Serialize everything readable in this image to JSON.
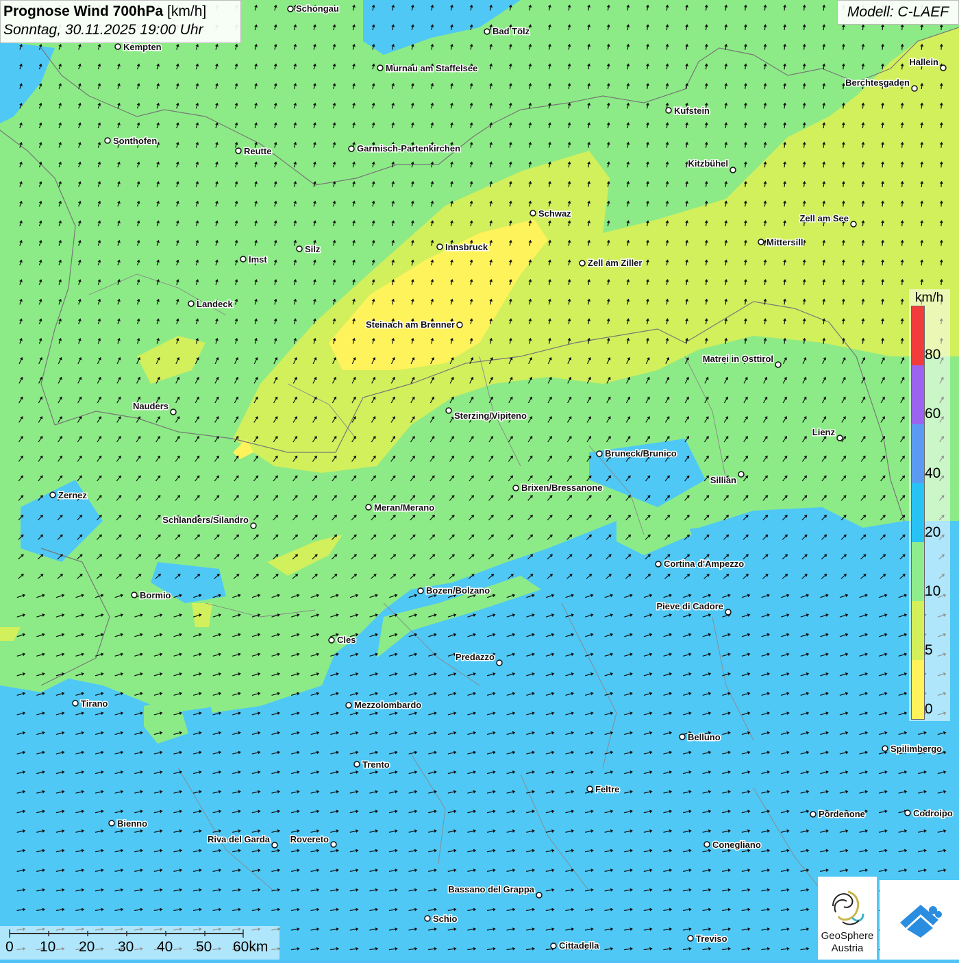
{
  "header": {
    "title_bold": "Prognose Wind 700hPa",
    "title_unit": "[km/h]",
    "datetime": "Sonntag, 30.11.2025 19:00 Uhr",
    "model": "Modell: C-LAEF"
  },
  "legend": {
    "unit": "km/h",
    "labels": [
      "80",
      "60",
      "40",
      "20",
      "10",
      "5",
      "0"
    ],
    "colors": [
      "#f23c3c",
      "#9b63f0",
      "#5b9af2",
      "#28c3f5",
      "#8fec8c",
      "#d3f05a",
      "#fff25a"
    ]
  },
  "scale_bar": {
    "labels": [
      "0",
      "10",
      "20",
      "30",
      "40",
      "50",
      "60km"
    ]
  },
  "logos": {
    "geosphere_line1": "GeoSphere",
    "geosphere_line2": "Austria"
  },
  "cities": [
    {
      "name": "Schongau"
    },
    {
      "name": "Bad Tölz"
    },
    {
      "name": "Kempten"
    },
    {
      "name": "Murnau am Staffelsee"
    },
    {
      "name": "Hallein"
    },
    {
      "name": "Berchtesgaden"
    },
    {
      "name": "Kufstein"
    },
    {
      "name": "Sonthofen"
    },
    {
      "name": "Reutte"
    },
    {
      "name": "Garmisch-Partenkirchen"
    },
    {
      "name": "Kitzbühel"
    },
    {
      "name": "Schwaz"
    },
    {
      "name": "Zell am See"
    },
    {
      "name": "Innsbruck"
    },
    {
      "name": "Mittersill"
    },
    {
      "name": "Silz"
    },
    {
      "name": "Imst"
    },
    {
      "name": "Zell am Ziller"
    },
    {
      "name": "Landeck"
    },
    {
      "name": "Steinach am Brenner"
    },
    {
      "name": "Matrei in Osttirol"
    },
    {
      "name": "Nauders"
    },
    {
      "name": "Sterzing/Vipiteno"
    },
    {
      "name": "Lienz"
    },
    {
      "name": "Bruneck/Brunico"
    },
    {
      "name": "Sillian"
    },
    {
      "name": "Brixen/Bressanone"
    },
    {
      "name": "Zernez"
    },
    {
      "name": "Meran/Merano"
    },
    {
      "name": "Schlanders/Silandro"
    },
    {
      "name": "Cortina d'Ampezzo"
    },
    {
      "name": "Bozen/Bolzano"
    },
    {
      "name": "Bormio"
    },
    {
      "name": "Pieve di Cadore"
    },
    {
      "name": "Cles"
    },
    {
      "name": "Predazzo"
    },
    {
      "name": "Tirano"
    },
    {
      "name": "Mezzolombardo"
    },
    {
      "name": "Belluno"
    },
    {
      "name": "Spilimbergo"
    },
    {
      "name": "Trento"
    },
    {
      "name": "Feltre"
    },
    {
      "name": "Pordenone"
    },
    {
      "name": "Codroipo"
    },
    {
      "name": "Bienno"
    },
    {
      "name": "Riva del Garda"
    },
    {
      "name": "Rovereto"
    },
    {
      "name": "Conegliano"
    },
    {
      "name": "Bassano del Grappa"
    },
    {
      "name": "Schio"
    },
    {
      "name": "Treviso"
    },
    {
      "name": "Cittadella"
    }
  ]
}
